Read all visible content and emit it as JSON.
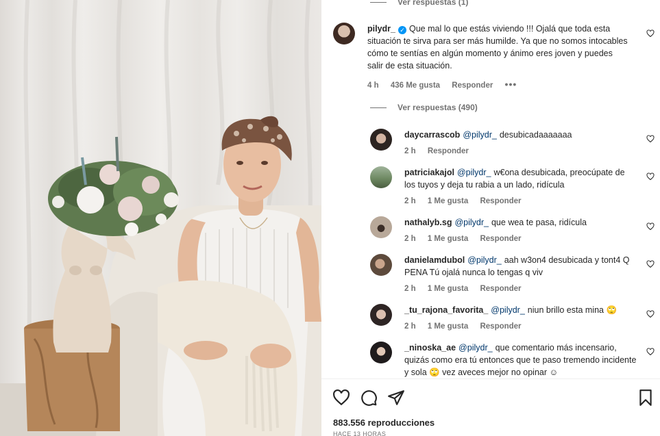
{
  "post": {
    "top_view_replies": "Ver respuestas (1)",
    "main_comment": {
      "username": "pilydr_",
      "text": "Que mal lo que estás viviendo !!! Ojalá que toda esta situación te sirva para ser más humilde. Ya que no somos intocables cómo te sentías en algún momento y ánimo eres joven y puedes salir de esta situación.",
      "time": "4 h",
      "likes": "436 Me gusta",
      "reply": "Responder",
      "more": "•••",
      "view_replies": "Ver respuestas (490)"
    },
    "replies": [
      {
        "username": "daycarrascob",
        "mention": "@pilydr_",
        "text": "desubicadaaaaaaa",
        "time": "2 h",
        "likes": "",
        "reply": "Responder"
      },
      {
        "username": "patriciakajol",
        "mention": "@pilydr_",
        "text": "w€ona desubicada, preocúpate de los tuyos y deja tu rabia a un lado, ridícula",
        "time": "2 h",
        "likes": "1 Me gusta",
        "reply": "Responder"
      },
      {
        "username": "nathalyb.sg",
        "mention": "@pilydr_",
        "text": "que wea te pasa, ridícula",
        "time": "2 h",
        "likes": "1 Me gusta",
        "reply": "Responder"
      },
      {
        "username": "danielamdubol",
        "mention": "@pilydr_",
        "text": "aah w3on4 desubicada y tont4 Q PENA Tú ojalá nunca lo tengas q viv",
        "time": "2 h",
        "likes": "1 Me gusta",
        "reply": "Responder"
      },
      {
        "username": "_tu_rajona_favorita_",
        "mention": "@pilydr_",
        "text": "niun brillo esta mina 🙄",
        "time": "2 h",
        "likes": "1 Me gusta",
        "reply": "Responder"
      },
      {
        "username": "_ninoska_ae",
        "mention": "@pilydr_",
        "text": "que comentario más incensario, quizás como era tú entonces que te paso tremendo incidente y sola 🙄 vez aveces mejor no opinar ☺",
        "time": "",
        "likes": "",
        "reply": ""
      }
    ]
  },
  "footer": {
    "views": "883.556 reproducciones",
    "ago": "HACE 13 HORAS"
  },
  "icons": {
    "like": "heart-icon",
    "comment": "comment-icon",
    "share": "share-icon",
    "save": "bookmark-icon",
    "verified": "verified-badge-icon"
  },
  "colors": {
    "text": "#262626",
    "secondary": "#737373",
    "mention": "#00376b",
    "verified": "#0095f6"
  }
}
